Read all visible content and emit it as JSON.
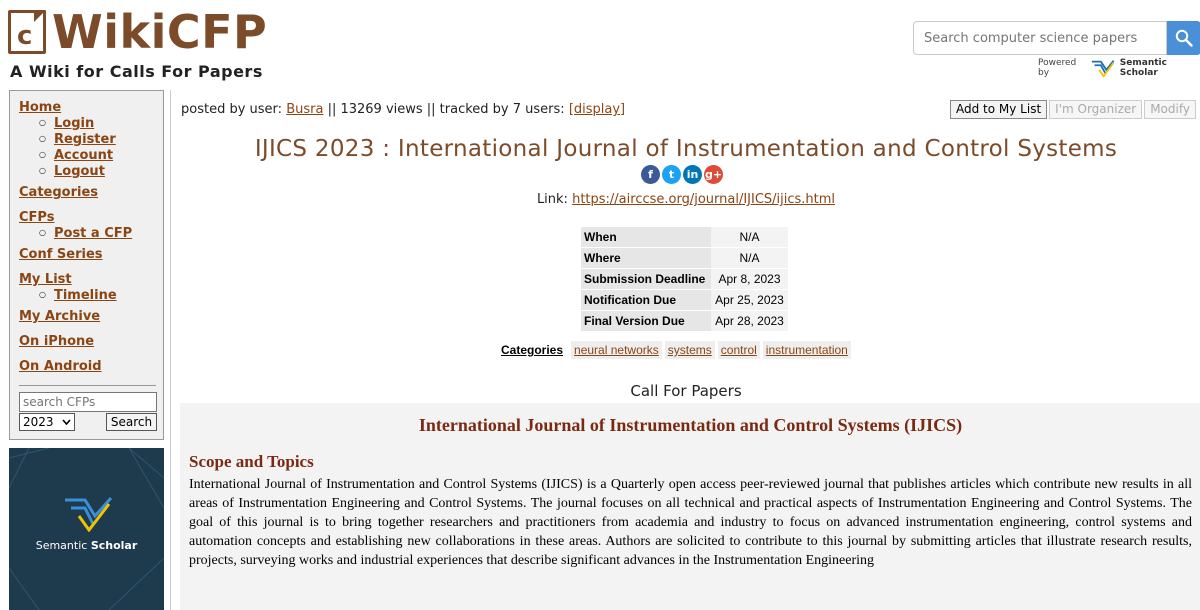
{
  "header": {
    "site_name": "WikiCFP",
    "logo_letter": "c",
    "tagline": "A Wiki for Calls For Papers",
    "search_placeholder": "Search computer science papers",
    "powered_by": "Powered by",
    "powered_name": "Semantic Scholar"
  },
  "sidebar": {
    "home": "Home",
    "login": "Login",
    "register": "Register",
    "account": "Account",
    "logout": "Logout",
    "categories": "Categories",
    "cfps": "CFPs",
    "post_cfp": "Post a CFP",
    "conf_series": "Conf Series",
    "my_list": "My List",
    "timeline": "Timeline",
    "my_archive": "My Archive",
    "on_iphone": "On iPhone",
    "on_android": "On Android",
    "search_placeholder": "search CFPs",
    "year": "2023",
    "search_button": "Search"
  },
  "ad": {
    "brand_light": "Semantic ",
    "brand_bold": "Scholar"
  },
  "main": {
    "posted_prefix": "posted by user: ",
    "posted_user": "Busra",
    "posted_mid": " || 13269 views || tracked by 7 users: ",
    "display_link": "[display]",
    "buttons": {
      "add": "Add to My List",
      "organizer": "I'm Organizer",
      "modify": "Modify"
    },
    "title": "IJICS 2023 : International Journal of Instrumentation and Control Systems",
    "share": [
      "f",
      "t",
      "in",
      "g+"
    ],
    "link_label": "Link: ",
    "link_url": "https://airccse.org/journal/IJICS/ijics.html",
    "info": {
      "when_k": "When",
      "when_v": "N/A",
      "where_k": "Where",
      "where_v": "N/A",
      "sub_k": "Submission Deadline",
      "sub_v": "Apr 8, 2023",
      "notif_k": "Notification Due",
      "notif_v": "Apr 25, 2023",
      "final_k": "Final Version Due",
      "final_v": "Apr 28, 2023"
    },
    "categories_label": "Categories",
    "categories": [
      "neural networks",
      "systems",
      "control",
      "instrumentation"
    ],
    "cfp_heading": "Call For Papers",
    "journal_name": "International Journal of Instrumentation and Control Systems (IJICS)",
    "scope_title": "Scope and Topics",
    "scope_body": "International Journal of Instrumentation and Control Systems (IJICS) is a Quarterly open access peer-reviewed journal that publishes articles which contribute new results in all areas of Instrumentation Engineering and Control Systems. The journal focuses on all technical and practical aspects of Instrumentation Engineering and Control Systems. The goal of this journal is to bring together researchers and practitioners from academia and industry to focus on advanced instrumentation engineering, control systems and automation concepts and establishing new collaborations in these areas. Authors are solicited to contribute to this journal by submitting articles that illustrate research results, projects, surveying works and industrial experiences that describe significant advances in the Instrumentation Engineering"
  },
  "colors": {
    "brand_brown": "#7b4b2a",
    "link": "#8b4513",
    "search_blue": "#4a90d9",
    "facebook": "#3b5998",
    "twitter": "#1da1f2",
    "linkedin": "#0077b5",
    "google": "#dd4b39"
  }
}
